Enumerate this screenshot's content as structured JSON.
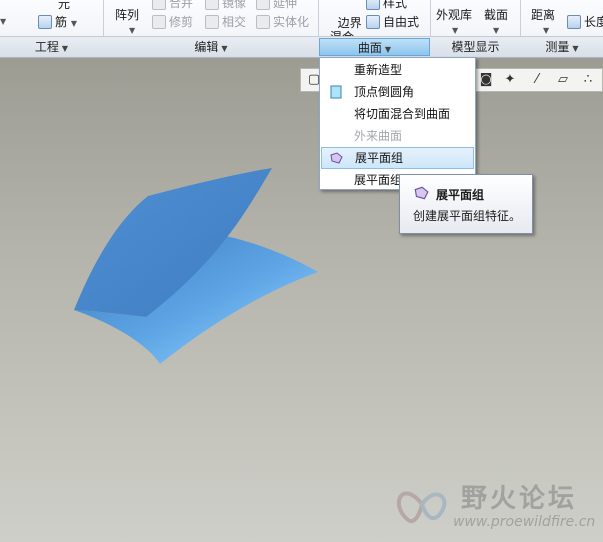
{
  "ribbon": {
    "col1": {
      "top_item": "元",
      "bottom_item": "筋"
    },
    "array_button": "阵列",
    "edit_items": {
      "merge": "合并",
      "trim": "修剪",
      "mirror": "镜像",
      "intersect": "相交",
      "extend": "延伸",
      "solidify": "实体化"
    },
    "boundary_blend": "边界\n混合",
    "freestyle": "自由式",
    "style_top": "样式",
    "appearance_gallery": "外观库",
    "section": "截面",
    "distance": "距离",
    "length": "长度",
    "groups": {
      "engineering": "工程",
      "editing": "编辑",
      "surfaces": "曲面",
      "model_display": "模型显示",
      "measure": "测量"
    }
  },
  "surface_menu": {
    "items": [
      {
        "label": "重新造型",
        "state": "normal"
      },
      {
        "label": "顶点倒圆角",
        "state": "normal"
      },
      {
        "label": "将切面混合到曲面",
        "state": "normal"
      },
      {
        "label": "外来曲面",
        "state": "disabled"
      },
      {
        "label": "展平面组",
        "state": "hover"
      },
      {
        "label": "展平面组",
        "state": "normal"
      }
    ]
  },
  "tooltip": {
    "title": "展平面组",
    "description": "创建展平面组特征。"
  },
  "watermark": {
    "title": "野火论坛",
    "url": "www.proewildfire.cn"
  },
  "colors": {
    "surface_blue": "#4a86c8",
    "surface_light": "#8fd0ff",
    "menu_hover": "#cde6f9"
  }
}
